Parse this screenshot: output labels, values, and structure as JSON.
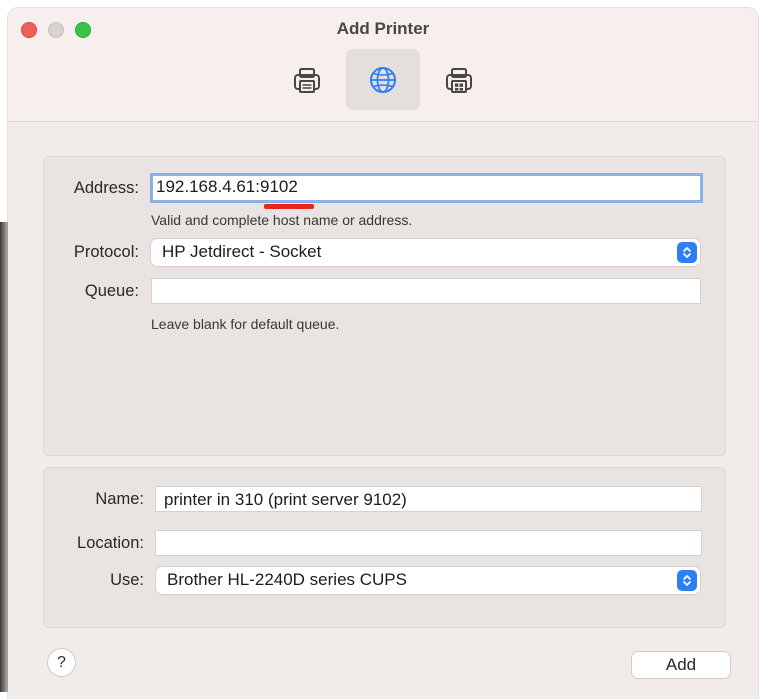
{
  "window": {
    "title": "Add Printer"
  },
  "toolbar": {
    "tabs": [
      {
        "icon": "printer-icon",
        "selected": false
      },
      {
        "icon": "globe-icon",
        "selected": true
      },
      {
        "icon": "windows-printer-icon",
        "selected": false
      }
    ]
  },
  "ip_panel": {
    "address_label": "Address:",
    "address_value": "192.168.4.61:9102",
    "address_hint": "Valid and complete host name or address.",
    "protocol_label": "Protocol:",
    "protocol_value": "HP Jetdirect - Socket",
    "queue_label": "Queue:",
    "queue_value": "",
    "queue_hint": "Leave blank for default queue."
  },
  "details_panel": {
    "name_label": "Name:",
    "name_value": "printer in 310 (print server 9102)",
    "location_label": "Location:",
    "location_value": "",
    "use_label": "Use:",
    "use_value": "Brother HL-2240D series CUPS"
  },
  "footer": {
    "help_label": "?",
    "add_label": "Add"
  },
  "colors": {
    "accent": "#2d7ff4",
    "annotation": "#e8241c",
    "window_bg": "#f1ece9"
  }
}
